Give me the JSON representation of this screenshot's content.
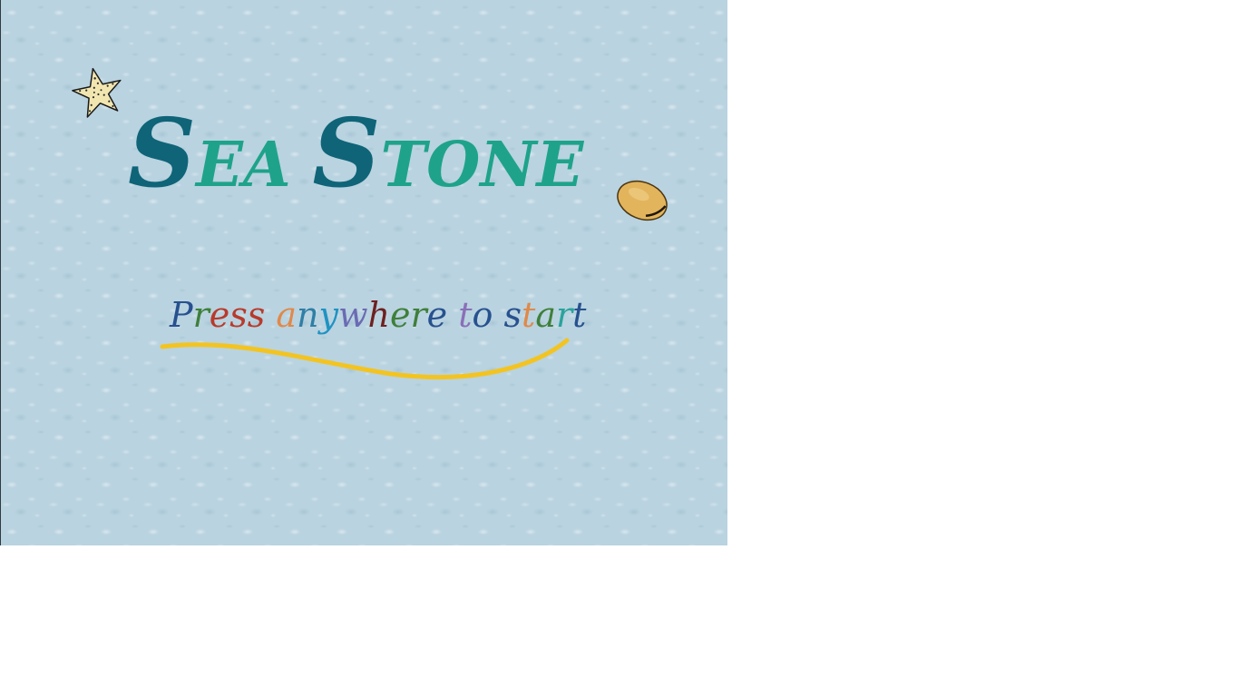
{
  "title": {
    "text": "Sea Stone",
    "primary_color": "#0f6478",
    "secondary_color": "#1ea38a"
  },
  "prompt": {
    "text": "Press anywhere to start",
    "letter_colors": [
      "#27518f",
      "#3f7f3a",
      "#b83a2c",
      "#b83a2c",
      "#b83a2c",
      "",
      "#e0894a",
      "#2f7fa6",
      "#1f93c2",
      "#6b6bb3",
      "#6e2020",
      "#3f7f3a",
      "#3f7f3a",
      "",
      "#2f7fa6",
      "#8a6fb8",
      "",
      "#b83a2c",
      "#27518f",
      "#e0894a",
      "#3f7f3a",
      "#2aa39b"
    ],
    "underline_color": "#f3c421"
  },
  "decorations": {
    "starfish": "starfish-icon",
    "starfish_color": "#f2e6b0",
    "stone": "sea-stone-icon",
    "stone_color": "#e2b45c"
  },
  "stage": {
    "background": "#b9d3e0"
  }
}
